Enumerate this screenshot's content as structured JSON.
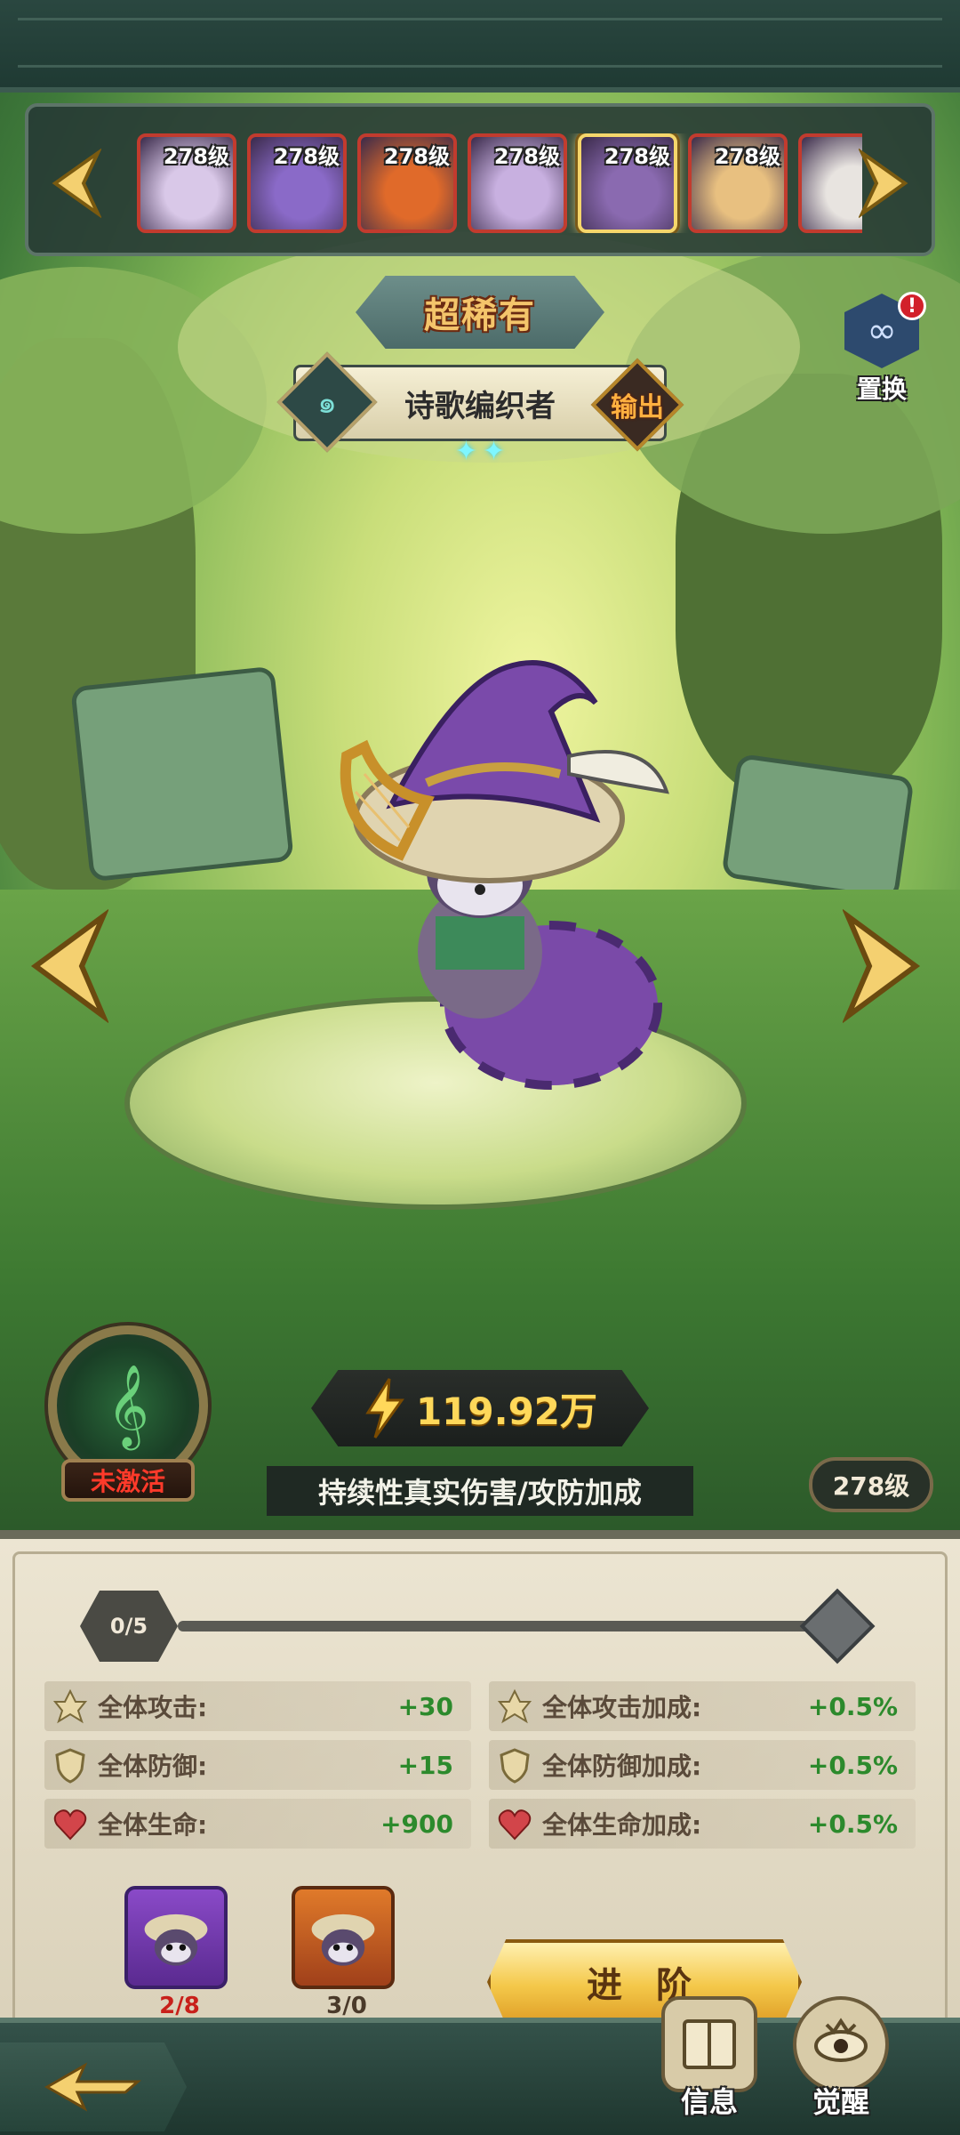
{
  "hero_list": {
    "items": [
      {
        "level": "278级",
        "tint": "#d9c8e8"
      },
      {
        "level": "278级",
        "tint": "#8a6ac8"
      },
      {
        "level": "278级",
        "tint": "#e06a2a"
      },
      {
        "level": "278级",
        "tint": "#c8b0e0"
      },
      {
        "level": "278级",
        "tint": "#8a6ab0",
        "selected": true
      },
      {
        "level": "278级",
        "tint": "#e8c080"
      },
      {
        "level": "",
        "tint": "#e8e4e0"
      }
    ]
  },
  "hero": {
    "rarity": "超稀有",
    "name": "诗歌编织者",
    "role_tag": "输出",
    "stars": [
      "✦",
      "✦"
    ],
    "power": "119.92万",
    "specialty": "持续性真实伤害/攻防加成",
    "level": "278级"
  },
  "swap": {
    "label": "置换",
    "alert": "!"
  },
  "relic": {
    "status": "未激活",
    "icon": "treble-clef-icon"
  },
  "advance_panel": {
    "progress_label": "0/5",
    "progress_fraction": 0,
    "stats_left": [
      {
        "icon": "attack-icon",
        "label": "全体攻击:",
        "value": "+30"
      },
      {
        "icon": "defense-icon",
        "label": "全体防御:",
        "value": "+15"
      },
      {
        "icon": "heart-icon",
        "label": "全体生命:",
        "value": "+900"
      }
    ],
    "stats_right": [
      {
        "icon": "attack-icon",
        "label": "全体攻击加成:",
        "value": "+0.5%"
      },
      {
        "icon": "defense-icon",
        "label": "全体防御加成:",
        "value": "+0.5%"
      },
      {
        "icon": "heart-icon",
        "label": "全体生命加成:",
        "value": "+0.5%"
      }
    ],
    "materials": [
      {
        "count": "2/8",
        "rarity": "purple"
      },
      {
        "count": "3/0",
        "rarity": "orange"
      }
    ],
    "advance_label": "进 阶"
  },
  "bottom_bar": {
    "info_label": "信息",
    "awaken_label": "觉醒"
  },
  "colors": {
    "gold": "#f4c84a",
    "stat_value": "#2c8a2c",
    "inactive_red": "#ff3a2a"
  }
}
